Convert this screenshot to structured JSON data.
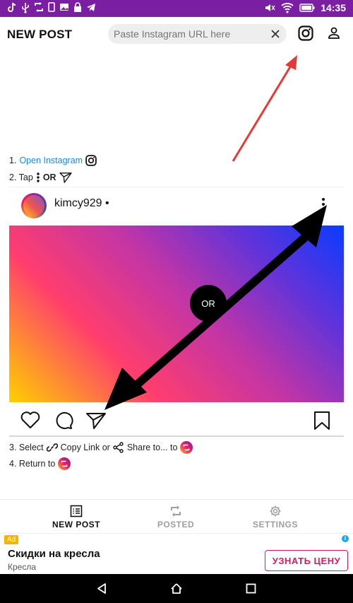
{
  "status_bar": {
    "time": "14:35",
    "background": "#7b1fa2"
  },
  "header": {
    "title": "NEW POST",
    "url_placeholder": "Paste Instagram URL here"
  },
  "instructions": {
    "step1_prefix": "1. ",
    "step1_link": "Open Instagram",
    "step2_prefix": "2. Tap",
    "step2_or": "OR",
    "step3_prefix": "3. Select",
    "step3_copy": "Copy Link or",
    "step3_share": "Share to... to",
    "step4_prefix": "4. Return to"
  },
  "post": {
    "username": "kimcy929 •",
    "or_label": "OR"
  },
  "bottom_nav": {
    "items": [
      {
        "label": "NEW POST",
        "icon": "list-icon",
        "active": true
      },
      {
        "label": "POSTED",
        "icon": "repost-icon",
        "active": false
      },
      {
        "label": "SETTINGS",
        "icon": "gear-icon",
        "active": false
      }
    ]
  },
  "ad": {
    "badge": "Ad",
    "title": "Скидки на кресла",
    "subtitle": "Кресла",
    "cta": "УЗНАТЬ ЦЕНУ"
  },
  "colors": {
    "accent_link": "#1e88e5",
    "ad_cta": "#d81b60",
    "arrow_red": "#e53935"
  }
}
